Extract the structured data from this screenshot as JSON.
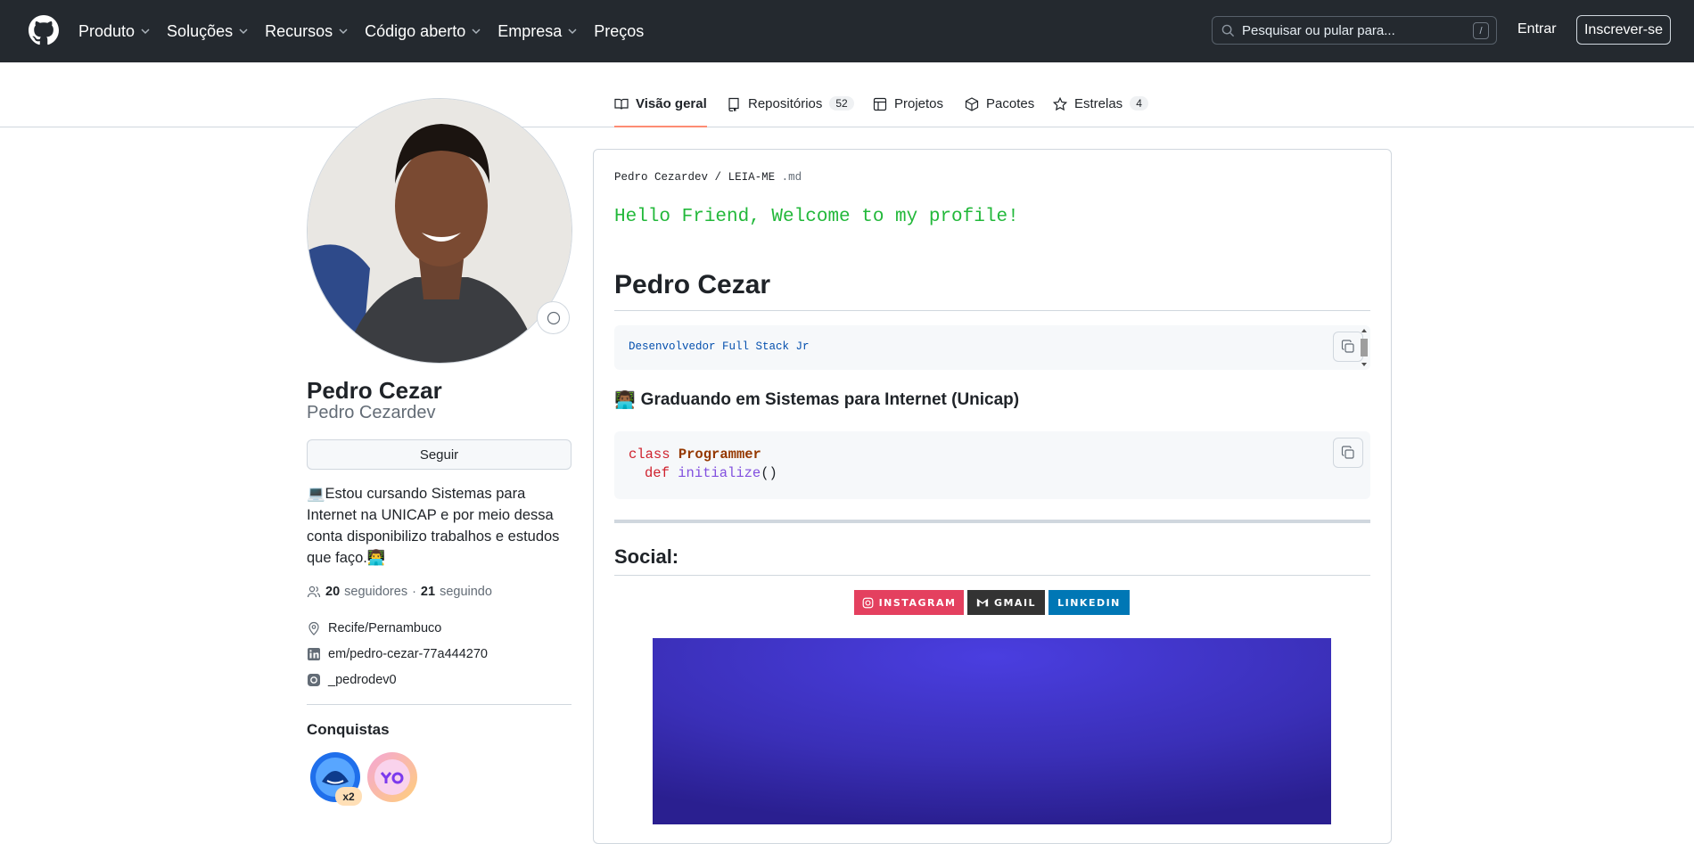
{
  "header": {
    "nav": [
      "Produto",
      "Soluções",
      "Recursos",
      "Código aberto",
      "Empresa",
      "Preços"
    ],
    "search_placeholder": "Pesquisar ou pular para...",
    "search_shortcut": "/",
    "signin": "Entrar",
    "signup": "Inscrever-se"
  },
  "tabs": {
    "overview": "Visão geral",
    "repos": "Repositórios",
    "repos_count": "52",
    "projects": "Projetos",
    "packages": "Pacotes",
    "stars": "Estrelas",
    "stars_count": "4"
  },
  "profile": {
    "name": "Pedro Cezar",
    "login": "Pedro Cezardev",
    "follow": "Seguir",
    "bio": "💻Estou cursando Sistemas para Internet na UNICAP e por meio dessa conta disponibilizo trabalhos e estudos que faço.👨‍💻",
    "followers": "20",
    "followers_label": "seguidores",
    "dot": "·",
    "following": "21",
    "following_label": "seguindo",
    "location": "Recife/Pernambuco",
    "linkedin": "em/pedro-cezar-77a444270",
    "instagram": "_pedrodev0",
    "achievements_title": "Conquistas",
    "badge_multiplier": "x2"
  },
  "readme": {
    "crumb_user": "Pedro Cezardev",
    "crumb_sep": "/",
    "crumb_file": "LEIA-ME",
    "crumb_ext": ".md",
    "hello": "Hello Friend, Welcome to my profile!",
    "h1": "Pedro Cezar",
    "code1": "Desenvolvedor Full Stack Jr",
    "h3_emoji": "👨🏾‍💻",
    "h3": "Graduando em Sistemas para Internet (Unicap)",
    "code2_kw1": "class",
    "code2_cls": "Programmer",
    "code2_kw2": "def",
    "code2_fn": "initialize",
    "code2_parens": "()",
    "social_title": "Social:",
    "badges": [
      "INSTAGRAM",
      "GMAIL",
      "LINKEDIN"
    ]
  },
  "colors": {
    "header_bg": "#24292f",
    "tab_underline": "#fd8c73",
    "instagram": "#e4405f",
    "gmail": "#333333",
    "linkedin": "#0077b5",
    "hello_green": "#22b83a",
    "banner": "#3a2fb7"
  }
}
